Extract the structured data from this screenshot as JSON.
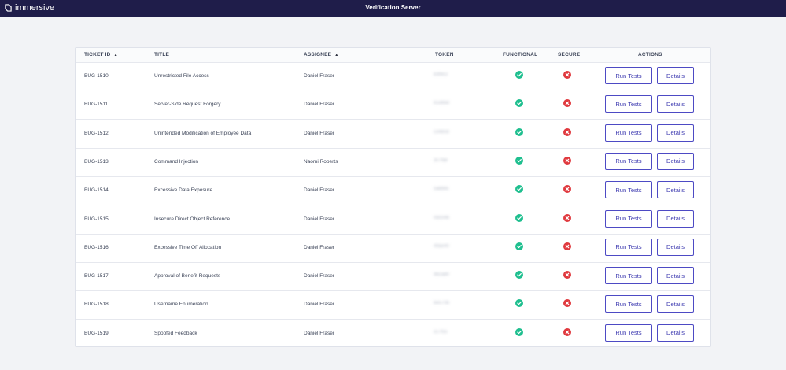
{
  "header": {
    "brand": "immersive",
    "title": "Verification Server"
  },
  "table": {
    "columns": {
      "ticket_id": "TICKET ID",
      "title": "TITLE",
      "assignee": "ASSIGNEE",
      "token": "TOKEN",
      "functional": "FUNCTIONAL",
      "secure": "SECURE",
      "actions": "ACTIONS"
    },
    "rows": [
      {
        "id": "BUG-1510",
        "title": "Unrestricted File Access",
        "assignee": "Daniel Fraser",
        "token": "83f9c3",
        "functional": "pass",
        "secure": "fail",
        "run": "Run Tests",
        "details": "Details"
      },
      {
        "id": "BUG-1511",
        "title": "Server-Side Request Forgery",
        "assignee": "Daniel Fraser",
        "token": "81d6bd",
        "functional": "pass",
        "secure": "fail",
        "run": "Run Tests",
        "details": "Details"
      },
      {
        "id": "BUG-1512",
        "title": "Unintended Modification of Employee Data",
        "assignee": "Daniel Fraser",
        "token": "c34b0d",
        "functional": "pass",
        "secure": "fail",
        "run": "Run Tests",
        "details": "Details"
      },
      {
        "id": "BUG-1513",
        "title": "Command Injection",
        "assignee": "Naomi Roberts",
        "token": "3c7fae",
        "functional": "pass",
        "secure": "fail",
        "run": "Run Tests",
        "details": "Details"
      },
      {
        "id": "BUG-1514",
        "title": "Excessive Data Exposure",
        "assignee": "Daniel Fraser",
        "token": "5a8b6c",
        "functional": "pass",
        "secure": "fail",
        "run": "Run Tests",
        "details": "Details"
      },
      {
        "id": "BUG-1515",
        "title": "Insecure Direct Object Reference",
        "assignee": "Daniel Fraser",
        "token": "0d3348",
        "functional": "pass",
        "secure": "fail",
        "run": "Run Tests",
        "details": "Details"
      },
      {
        "id": "BUG-1516",
        "title": "Excessive Time Off Allocation",
        "assignee": "Daniel Fraser",
        "token": "49ae40",
        "functional": "pass",
        "secure": "fail",
        "run": "Run Tests",
        "details": "Details"
      },
      {
        "id": "BUG-1517",
        "title": "Approval of Benefit Requests",
        "assignee": "Daniel Fraser",
        "token": "982a80",
        "functional": "pass",
        "secure": "fail",
        "run": "Run Tests",
        "details": "Details"
      },
      {
        "id": "BUG-1518",
        "title": "Username Enumeration",
        "assignee": "Daniel Fraser",
        "token": "be570b",
        "functional": "pass",
        "secure": "fail",
        "run": "Run Tests",
        "details": "Details"
      },
      {
        "id": "BUG-1519",
        "title": "Spoofed Feedback",
        "assignee": "Daniel Fraser",
        "token": "cc7f55",
        "functional": "pass",
        "secure": "fail",
        "run": "Run Tests",
        "details": "Details"
      }
    ]
  },
  "colors": {
    "topbar": "#1f1d4a",
    "pass": "#1fbf8f",
    "fail": "#e0393e",
    "accent": "#4d4ac4"
  }
}
